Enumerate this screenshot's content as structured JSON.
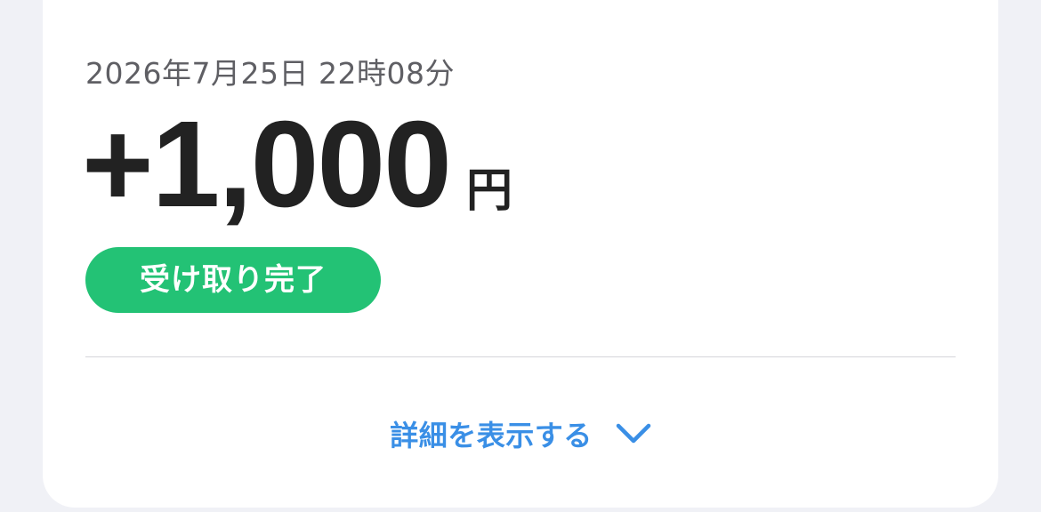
{
  "transaction": {
    "datetime": "2026年7月25日 22時08分",
    "amount": "+1,000",
    "currency": "円",
    "status": "受け取り完了"
  },
  "details": {
    "toggle_label": "詳細を表示する",
    "icon": "chevron-down-icon"
  },
  "colors": {
    "status_green": "#23c275",
    "link_blue": "#3a8fe6",
    "background": "#f0f1f6"
  }
}
